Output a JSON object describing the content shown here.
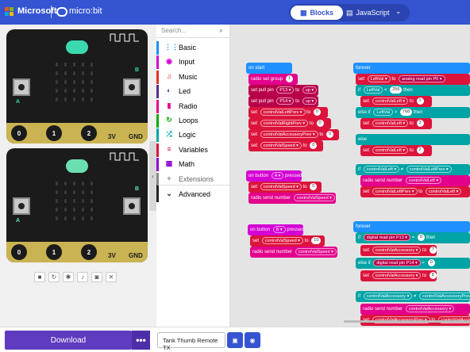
{
  "header": {
    "brand": "Microsoft",
    "product": "micro:bit",
    "tabs": {
      "blocks": "Blocks",
      "javascript": "JavaScript"
    }
  },
  "simulator": {
    "pins": [
      "0",
      "1",
      "2",
      "3V",
      "GND"
    ],
    "button_a": "A",
    "button_b": "B",
    "controls": [
      "stop-icon",
      "restart-icon",
      "debug-icon",
      "mute-icon",
      "screenshot-icon",
      "fullscreen-icon"
    ]
  },
  "toolbox": {
    "search_placeholder": "Search...",
    "categories": [
      {
        "label": "Basic",
        "icon": "⋮⋮",
        "color": "#1e90ff"
      },
      {
        "label": "Input",
        "icon": "◉",
        "color": "#d400d4"
      },
      {
        "label": "Music",
        "icon": "♫",
        "color": "#e63022"
      },
      {
        "label": "Led",
        "icon": "◐",
        "color": "#5c2d91"
      },
      {
        "label": "Radio",
        "icon": "▮",
        "color": "#e3008c"
      },
      {
        "label": "Loops",
        "icon": "↻",
        "color": "#00aa00"
      },
      {
        "label": "Logic",
        "icon": "⤮",
        "color": "#00a4a6"
      },
      {
        "label": "Variables",
        "icon": "≡",
        "color": "#dc143c"
      },
      {
        "label": "Math",
        "icon": "▦",
        "color": "#9400d3"
      },
      {
        "label": "Extensions",
        "icon": "+",
        "color": "#888888"
      },
      {
        "label": "Advanced",
        "icon": "⌄",
        "color": "#222222"
      }
    ]
  },
  "footer": {
    "download": "Download",
    "more": "•••",
    "project_name": "Tank Thumb Remote TX"
  },
  "colors": {
    "accent": "#3454d1",
    "event": "#1e90ff",
    "variables": "#dc143c",
    "radio": "#e3008c",
    "logic": "#00a4a6",
    "pins": "#b8004a",
    "download": "#5f3bc0",
    "board_top": "#3ad9b0",
    "board_bottom": "#6ae0b0"
  }
}
